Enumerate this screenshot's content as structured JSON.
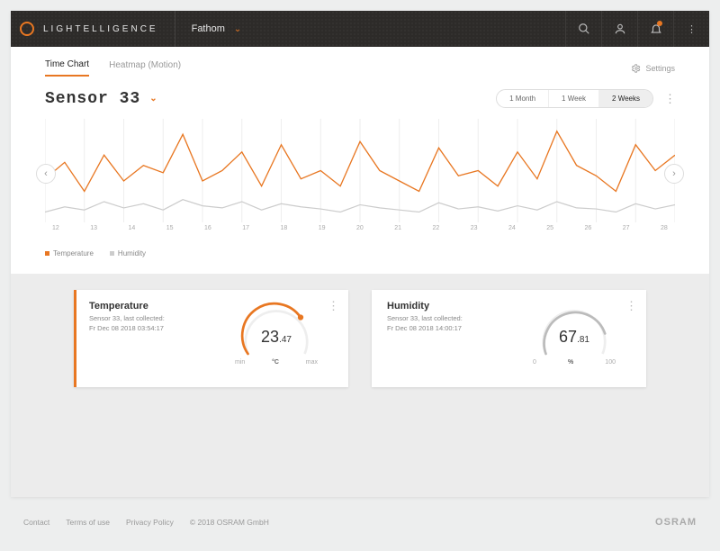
{
  "header": {
    "brand": "LIGHTELLIGENCE",
    "project": "Fathom"
  },
  "tabs": {
    "time_chart": "Time Chart",
    "heatmap": "Heatmap (Motion)",
    "settings": "Settings"
  },
  "sensor": {
    "title": "Sensor 33"
  },
  "range": {
    "month": "1 Month",
    "week": "1 Week",
    "two_weeks": "2 Weeks"
  },
  "chart_data": {
    "type": "line",
    "categories": [
      "12",
      "13",
      "14",
      "15",
      "16",
      "17",
      "18",
      "19",
      "20",
      "21",
      "22",
      "23",
      "24",
      "25",
      "26",
      "27",
      "28"
    ],
    "series": [
      {
        "name": "Temperature",
        "values": [
          42,
          58,
          30,
          65,
          40,
          55,
          48,
          85,
          40,
          50,
          68,
          35,
          75,
          42,
          50,
          35,
          78,
          50,
          40,
          30,
          72,
          45,
          50,
          35,
          68,
          42,
          88,
          55,
          45,
          30,
          75,
          50,
          65
        ]
      },
      {
        "name": "Humidity",
        "values": [
          10,
          15,
          12,
          20,
          14,
          18,
          12,
          22,
          16,
          14,
          20,
          12,
          18,
          15,
          13,
          10,
          17,
          14,
          12,
          10,
          19,
          13,
          15,
          11,
          16,
          12,
          20,
          14,
          13,
          10,
          18,
          13,
          17
        ]
      }
    ],
    "legend": {
      "temperature": "Temperature",
      "humidity": "Humidity"
    }
  },
  "cards": {
    "temperature": {
      "title": "Temperature",
      "sub1": "Sensor 33, last collected:",
      "sub2": "Fr Dec 08 2018 03:54:17",
      "value_int": "23",
      "value_dec": ".47",
      "min": "min",
      "unit": "°C",
      "max": "max"
    },
    "humidity": {
      "title": "Humidity",
      "sub1": "Sensor 33, last collected:",
      "sub2": "Fr Dec 08 2018 14:00:17",
      "value_int": "67",
      "value_dec": ".81",
      "min": "0",
      "unit": "%",
      "max": "100"
    }
  },
  "footer": {
    "contact": "Contact",
    "terms": "Terms of use",
    "privacy": "Privacy Policy",
    "copyright": "© 2018 OSRAM GmbH",
    "brand": "OSRAM"
  }
}
